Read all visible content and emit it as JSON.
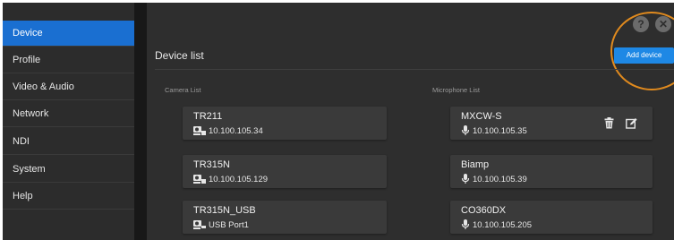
{
  "sidebar": {
    "items": [
      {
        "label": "Device",
        "active": true
      },
      {
        "label": "Profile",
        "active": false
      },
      {
        "label": "Video & Audio",
        "active": false
      },
      {
        "label": "Network",
        "active": false
      },
      {
        "label": "NDI",
        "active": false
      },
      {
        "label": "System",
        "active": false
      },
      {
        "label": "Help",
        "active": false
      }
    ]
  },
  "header": {
    "title": "Device list",
    "add_button": "Add device",
    "help_icon": "question-icon",
    "close_icon": "close-icon"
  },
  "camera_list": {
    "label": "Camera List",
    "items": [
      {
        "name": "TR211",
        "address": "10.100.105.34",
        "icon": "network-camera-icon"
      },
      {
        "name": "TR315N",
        "address": "10.100.105.129",
        "icon": "network-camera-icon"
      },
      {
        "name": "TR315N_USB",
        "address": "USB Port1",
        "icon": "usb-camera-icon"
      }
    ]
  },
  "microphone_list": {
    "label": "Microphone List",
    "items": [
      {
        "name": "MXCW-S",
        "address": "10.100.105.35",
        "icon": "microphone-icon"
      },
      {
        "name": "Biamp",
        "address": "10.100.105.39",
        "icon": "microphone-icon"
      },
      {
        "name": "CO360DX",
        "address": "10.100.105.205",
        "icon": "microphone-icon"
      }
    ]
  },
  "colors": {
    "accent": "#1a6fd1",
    "button": "#1e88e5",
    "highlight": "#e08a1e"
  }
}
